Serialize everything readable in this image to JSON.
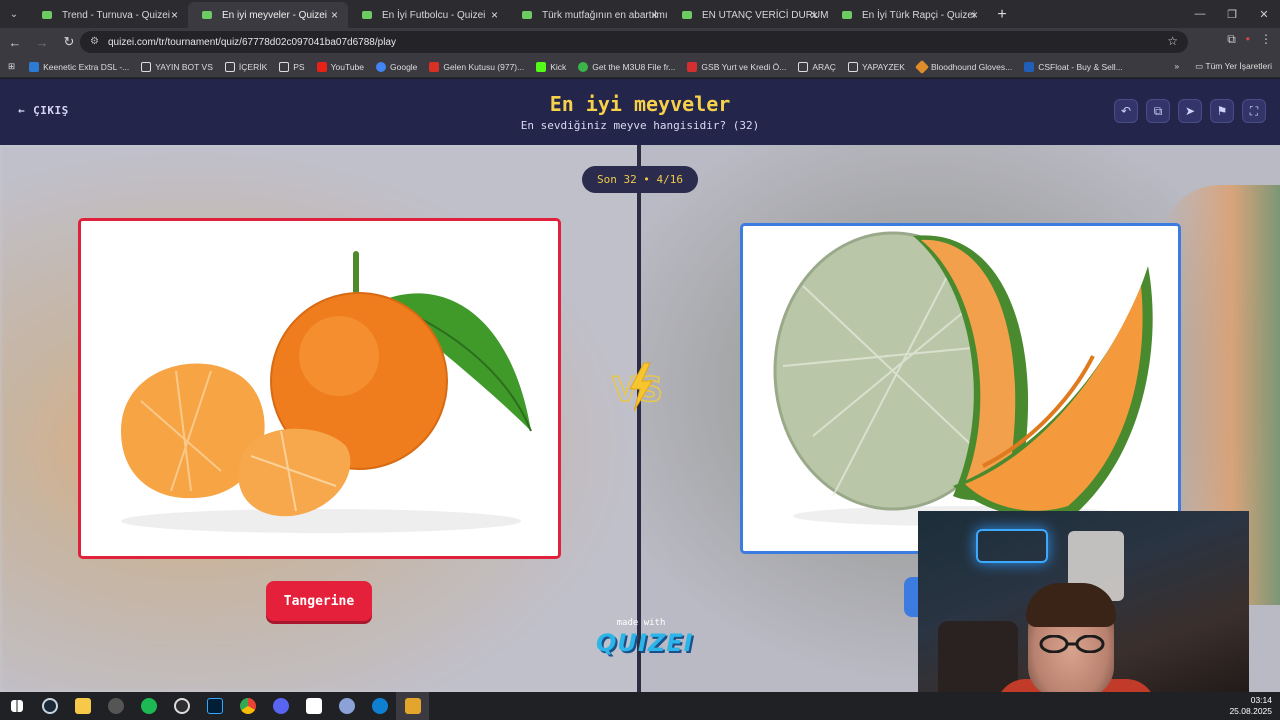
{
  "browser": {
    "tabs": [
      {
        "title": "Trend - Turnuva - Quizei",
        "active": false
      },
      {
        "title": "En iyi meyveler - Quizei",
        "active": true
      },
      {
        "title": "En İyi Futbolcu - Quizei",
        "active": false
      },
      {
        "title": "Türk mutfağının en abartılmış t",
        "active": false
      },
      {
        "title": "EN UTANÇ VERİCİ DURUMLAR",
        "active": false
      },
      {
        "title": "En İyi Türk Rapçi - Quizei",
        "active": false
      }
    ],
    "url": "quizei.com/tr/tournament/quiz/67778d02c097041ba07d6788/play",
    "bookmarks": [
      {
        "label": "Keenetic Extra DSL -...",
        "color": "#2e7bd6"
      },
      {
        "label": "YAYIN BOT VS",
        "color": "folder"
      },
      {
        "label": "İÇERİK",
        "color": "folder"
      },
      {
        "label": "PS",
        "color": "folder"
      },
      {
        "label": "YouTube",
        "color": "#e62117"
      },
      {
        "label": "Google",
        "color": "#4285f4"
      },
      {
        "label": "Gelen Kutusu (977)...",
        "color": "#d93025"
      },
      {
        "label": "Kick",
        "color": "#53fc18"
      },
      {
        "label": "Get the M3U8 File fr...",
        "color": "#3bb54a"
      },
      {
        "label": "GSB Yurt ve Kredi Ö...",
        "color": "#d32f2f"
      },
      {
        "label": "ARAÇ",
        "color": "folder"
      },
      {
        "label": "YAPAYZEK",
        "color": "folder"
      },
      {
        "label": "Bloodhound Gloves...",
        "color": "#e08c2a"
      },
      {
        "label": "CSFloat - Buy & Sell...",
        "color": "#1f5fb8"
      }
    ],
    "bookmarks_more": "»",
    "all_bookmarks": "Tüm Yer İşaretleri"
  },
  "header": {
    "exit_label": "ÇIKIŞ",
    "title": "En iyi meyveler",
    "subtitle": "En sevdiğiniz meyve hangisidir? (32)"
  },
  "progress": {
    "label": "Son 32 • 4/16",
    "current_match": 4,
    "total_matches": 16
  },
  "match": {
    "left_choice": "Tangerine",
    "vs_label": "VS"
  },
  "footer": {
    "made_with": "made with",
    "logo": "QUIZEI"
  },
  "taskbar": {
    "time": "03:14",
    "date": "25.08.2025"
  },
  "colors": {
    "header_bg": "#24254a",
    "title": "#f7d14a",
    "left_accent": "#e0213b",
    "right_accent": "#3c7be0"
  }
}
